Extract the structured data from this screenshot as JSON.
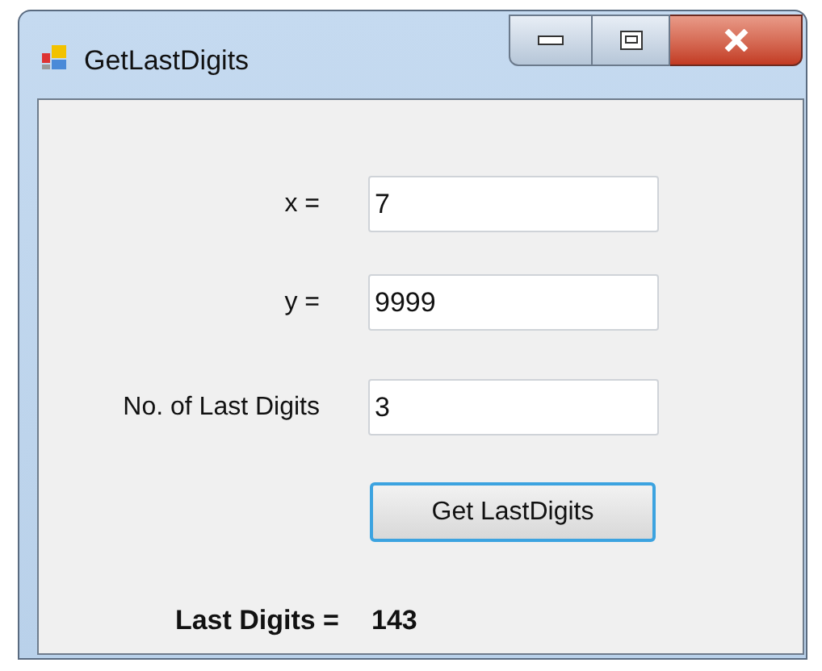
{
  "window": {
    "title": "GetLastDigits"
  },
  "fields": [
    {
      "label": "x =",
      "value": "7"
    },
    {
      "label": "y =",
      "value": "9999"
    },
    {
      "label": "No. of Last Digits",
      "value": "3"
    }
  ],
  "button": {
    "label": "Get LastDigits"
  },
  "result": {
    "label": "Last Digits =",
    "value": "143"
  }
}
